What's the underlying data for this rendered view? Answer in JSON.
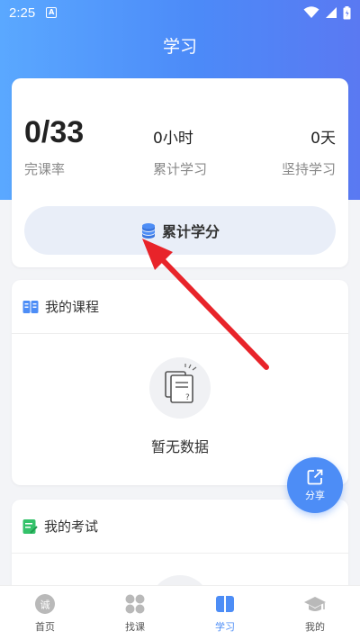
{
  "status_bar": {
    "time": "2:25",
    "notification_letter": "A"
  },
  "header": {
    "title": "学习"
  },
  "stats": {
    "completion": {
      "value": "0/33",
      "label": "完课率"
    },
    "hours": {
      "value": "0小时",
      "label": "累计学习"
    },
    "days": {
      "value": "0天",
      "label": "坚持学习"
    }
  },
  "credit_button": {
    "label": "累计学分"
  },
  "courses": {
    "title": "我的课程",
    "empty_text": "暂无数据"
  },
  "exams": {
    "title": "我的考试"
  },
  "share": {
    "label": "分享"
  },
  "tabbar": {
    "items": [
      {
        "label": "首页",
        "icon": "home-icon"
      },
      {
        "label": "找课",
        "icon": "find-course-icon"
      },
      {
        "label": "学习",
        "icon": "study-icon",
        "active": true
      },
      {
        "label": "我的",
        "icon": "graduation-cap-icon"
      }
    ]
  },
  "colors": {
    "accent": "#4d8df6",
    "annotation_arrow": "#e8242a"
  }
}
